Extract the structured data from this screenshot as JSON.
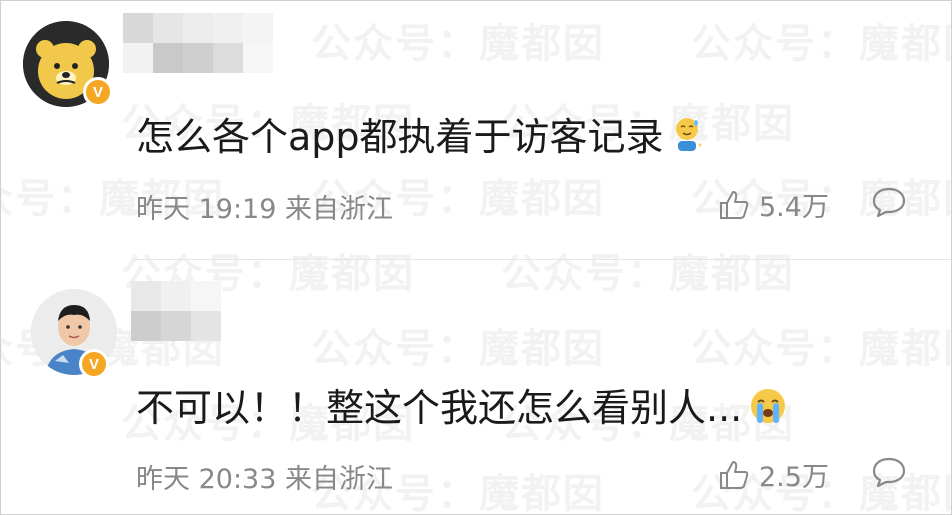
{
  "watermark_text": "公众号：魔都囡",
  "comments": [
    {
      "text": "怎么各个app都执着于访客记录",
      "emoji": "sweat-smile-icon",
      "time": "昨天 19:19",
      "location": "来自浙江",
      "likes": "5.4万",
      "verified": "V"
    },
    {
      "text": "不可以！！整这个我还怎么看别人...",
      "emoji": "crying-face-icon",
      "time": "昨天 20:33",
      "location": "来自浙江",
      "likes": "2.5万",
      "verified": "V"
    }
  ],
  "colors": {
    "badge": "#f5a623",
    "meta": "#888888",
    "text": "#1a1a1a"
  }
}
